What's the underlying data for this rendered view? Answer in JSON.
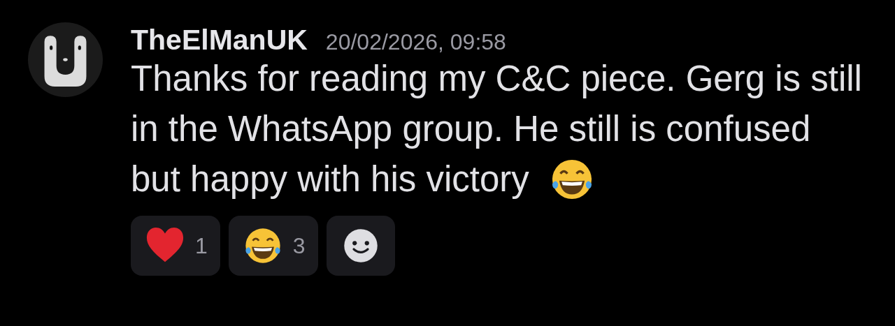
{
  "message": {
    "author": "TheElManUK",
    "timestamp": "20/02/2026, 09:58",
    "lines": [
      "Thanks for reading my C&C piece. Gerg is still",
      "in the WhatsApp group. He still is confused",
      "but happy with his victory"
    ],
    "trailing_emoji": {
      "kind": "laughing"
    }
  },
  "reactions": [
    {
      "kind": "heart",
      "count": "1"
    },
    {
      "kind": "laughing",
      "count": "3"
    }
  ]
}
